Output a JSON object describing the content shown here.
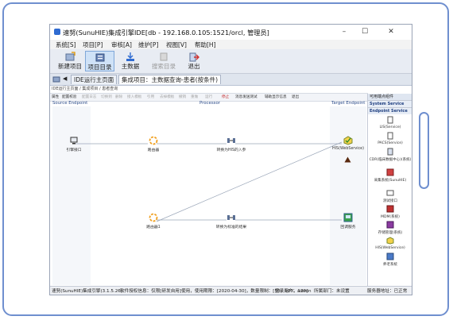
{
  "window": {
    "title": "速努(SunuHIE)集成引擎IDE[db - 192.168.0.105:1521/orcl, 管理员]",
    "minimize": "–",
    "maximize": "☐",
    "close": "✕"
  },
  "menu": [
    "系统[S]",
    "项目[P]",
    "审核[A]",
    "维护[P]",
    "视图[V]",
    "帮助[H]"
  ],
  "toolbar": {
    "new_project": "新建项目",
    "project_list": "项目目录",
    "main_data": "主数据",
    "search_list": "搜索目录",
    "exit": "退出"
  },
  "tabs": [
    "IDE运行主页面",
    "集成项目：主数据查询-患者(按条件)"
  ],
  "breadcrumb": "IDE运行主页面 / 集成项目 / 患者查询",
  "subtoolbar": [
    "属性",
    "配置校验",
    "配置日志",
    "切换到",
    "删除",
    "接入模板",
    "引用",
    "去掉模板",
    "撤销",
    "重做",
    "运行",
    "停止",
    "消息发送测试",
    "辅助显示信息",
    "退出"
  ],
  "sections": {
    "source": "Source Endpoint",
    "processor": "Processor",
    "target": "Target Endpoint"
  },
  "nodes": {
    "source": "引擎接口",
    "router1": "路由器",
    "transform1": "转换为HIS的入参",
    "target1": "HIS(WebService)",
    "router2": "路由器1",
    "transform2": "转换为标准的结果",
    "target2": "回调服务"
  },
  "palette": {
    "header": "可用端点组件",
    "sections": [
      "System Service",
      "Endpoint Service"
    ],
    "items": [
      "LIS(Service)",
      "PACS(Service)",
      "CDR(临床数据中心)(系统)",
      "采集系统(SunuHIE)",
      "测试接口",
      "MDM(系统)",
      "存储管理(系统)",
      "HIS(WebService)",
      "养老系统"
    ]
  },
  "status": {
    "product": "速努(SunuHIE)集成引擎(3.1.5.26)",
    "license": "软件授权信息：仅限[研发自用]使用，使用期限：[2020-04-30]，数量限制：[50，100，120]",
    "user": "登录用户：admin",
    "department": "所属部门：未设置",
    "server": "服务器地址：已正常"
  },
  "colors": {
    "frame": "#6f8fcf",
    "accent": "#2f6bd1",
    "router": "#f0a020",
    "target_green": "#3aa04a"
  }
}
